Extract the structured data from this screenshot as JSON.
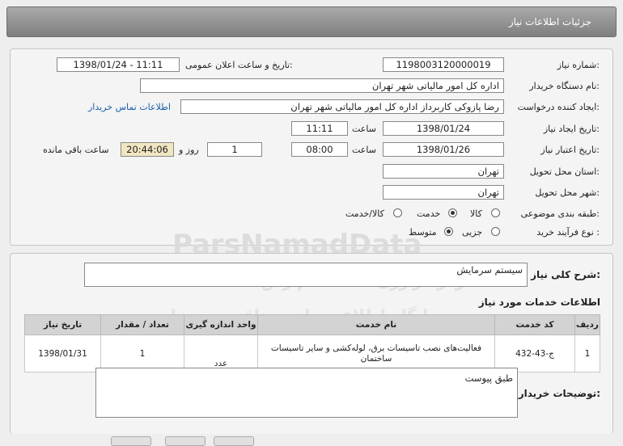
{
  "window_title": "جزئیات اطلاعات نیاز",
  "labels": {
    "need_number": "شماره نیاز:",
    "announce_datetime": "تاریخ و ساعت اعلان عمومی:",
    "buyer_org": "نام دستگاه خریدار:",
    "requester": "ایجاد کننده درخواست:",
    "contact_link": "اطلاعات تماس خریدار",
    "created_date": "تاریخ ایجاد نیاز:",
    "hour": "ساعت",
    "validity_date": "تاریخ اعتبار نیاز:",
    "day_and": "روز و",
    "remaining": "ساعت باقی مانده",
    "province": "استان محل تحویل:",
    "city": "شهر محل تحویل:",
    "category": "طبقه بندی موضوعی:",
    "process_type": "نوع فرآیند خرید :",
    "summary": "شرح کلی نیاز:",
    "services_heading": "اطلاعات خدمات مورد نیاز",
    "buyer_notes": "توضیحات خریدار:"
  },
  "values": {
    "need_number": "1198003120000019",
    "announce_datetime": "1398/01/24 - 11:11",
    "buyer_org": "اداره کل امور مالیاتی شهر تهران",
    "requester": "رضا  پازوکی کاربرداز اداره کل امور مالیاتی شهر تهران",
    "created_date": "1398/01/24",
    "created_time": "11:11",
    "validity_date": "1398/01/26",
    "validity_time": "08:00",
    "days_left": "1",
    "time_left": "20:44:06",
    "province": "تهران",
    "city": "تهران",
    "summary": "سیستم سرمایش",
    "buyer_notes": "طبق پیوست"
  },
  "category_options": [
    {
      "label": "کالا",
      "selected": false
    },
    {
      "label": "خدمت",
      "selected": true
    },
    {
      "label": "کالا/خدمت",
      "selected": false
    }
  ],
  "process_options": [
    {
      "label": "جزیی",
      "selected": false
    },
    {
      "label": "متوسط",
      "selected": true
    }
  ],
  "table": {
    "headers": [
      "ردیف",
      "کد خدمت",
      "نام خدمت",
      "واحد اندازه گیری",
      "تعداد / مقدار",
      "تاریخ نیاز"
    ],
    "rows": [
      [
        "1",
        "ج-43-432",
        "فعالیت‌های نصب تاسیسات برق، لوله‌کشی و سایر تاسیسات ساختمان",
        "عدد",
        "1",
        "1398/01/31"
      ]
    ]
  },
  "watermarks": [
    "ParsNamadData",
    "مرکز فرآوری اطلاعات پارس نماد داده ها",
    "پایگاه اطلاع رسانی مناقصه و مزایده",
    "۰۲۱ - ۸۸۳۴۹۶۷۰ - ۵"
  ],
  "colors": {
    "header_bg": "#8c8c8c",
    "link": "#1d5fa8",
    "time_left_bg": "#f1e6c2"
  }
}
